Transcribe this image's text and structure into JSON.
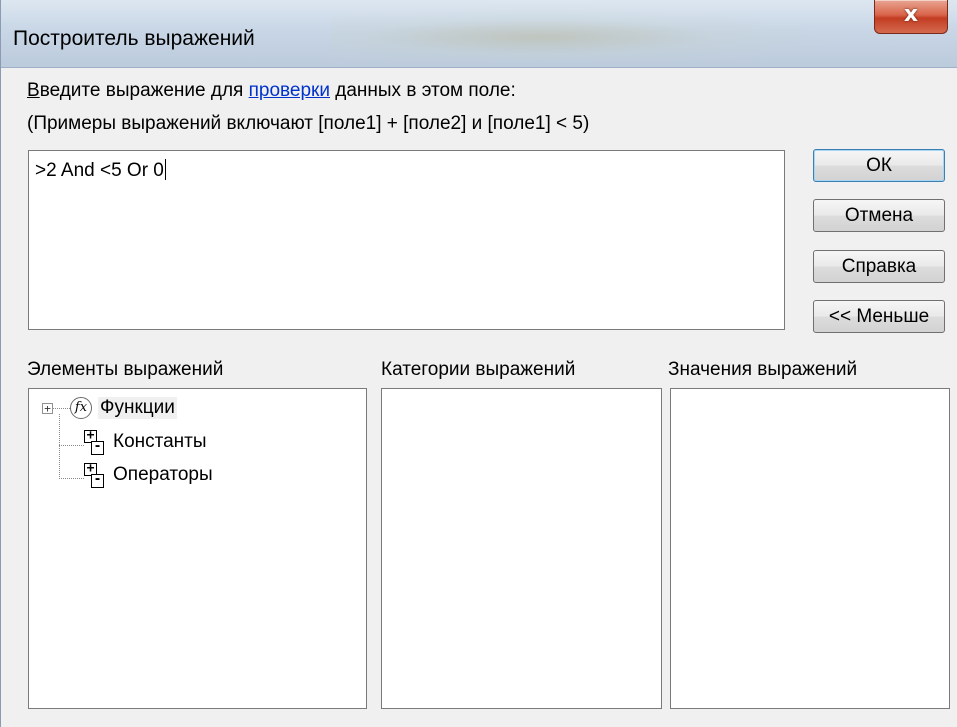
{
  "window": {
    "title": "Построитель выражений",
    "close_glyph": "x"
  },
  "instructions": {
    "line1_prefix": "В",
    "line1_a": "ведите выражение для ",
    "line1_link": "проверки",
    "line1_b": " данных в этом поле:",
    "line2": "(Примеры выражений включают [поле1] + [поле2] и [поле1] < 5)"
  },
  "expression": {
    "value": ">2 And <5 Or 0"
  },
  "buttons": {
    "ok": "ОК",
    "cancel": "Отмена",
    "help": "Справка",
    "less": "<< Меньше"
  },
  "panels": {
    "elements_label": "Элементы выражений",
    "categories_label": "Категории выражений",
    "values_label": "Значения выражений"
  },
  "tree": [
    {
      "label": "Функции",
      "icon": "function-icon",
      "expander": "+"
    },
    {
      "label": "Константы",
      "icon": "plus-minus-icon"
    },
    {
      "label": "Операторы",
      "icon": "plus-minus-icon"
    }
  ],
  "colors": {
    "link": "#0033cc",
    "close_button": "#c23d22",
    "dialog_bg": "#f0f0f0"
  }
}
